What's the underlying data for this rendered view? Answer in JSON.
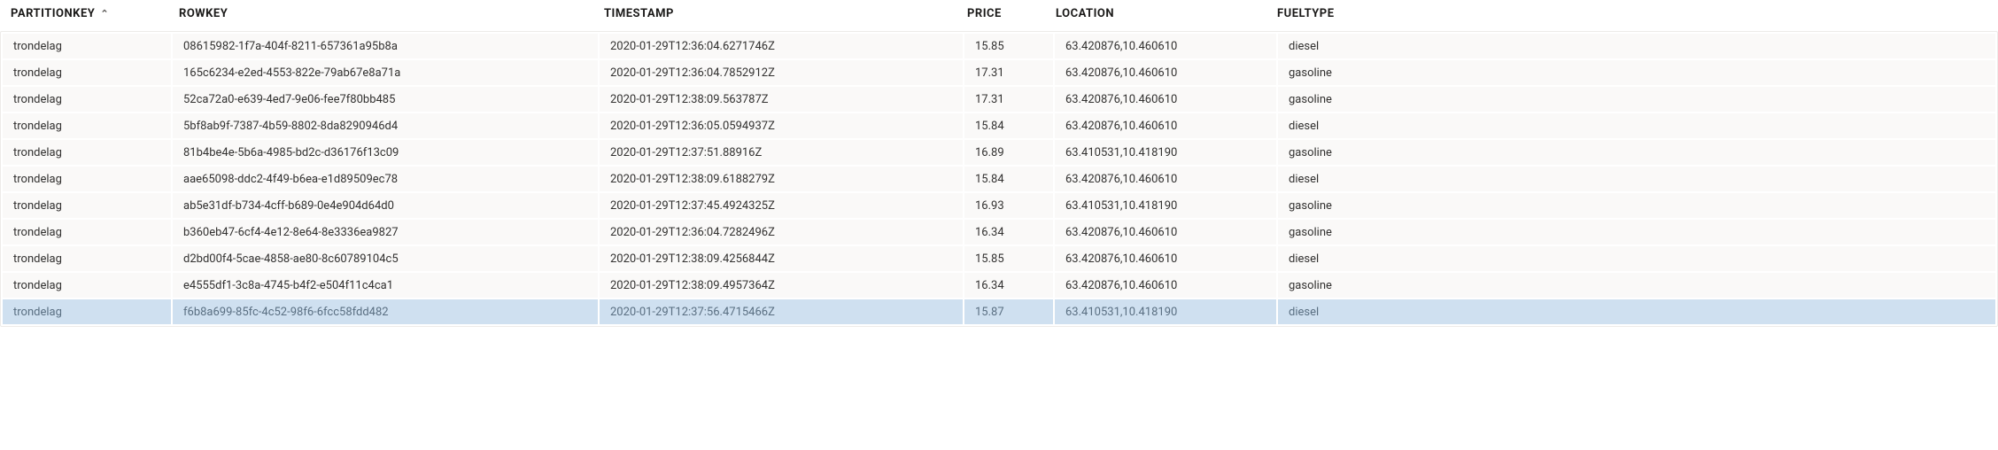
{
  "table": {
    "columns": [
      {
        "key": "partitionkey",
        "label": "PARTITIONKEY",
        "sorted": "asc"
      },
      {
        "key": "rowkey",
        "label": "ROWKEY"
      },
      {
        "key": "timestamp",
        "label": "TIMESTAMP"
      },
      {
        "key": "price",
        "label": "PRICE"
      },
      {
        "key": "location",
        "label": "LOCATION"
      },
      {
        "key": "fueltype",
        "label": "FUELTYPE"
      }
    ],
    "rows": [
      {
        "partitionkey": "trondelag",
        "rowkey": "08615982-1f7a-404f-8211-657361a95b8a",
        "timestamp": "2020-01-29T12:36:04.6271746Z",
        "price": "15.85",
        "location": "63.420876,10.460610",
        "fueltype": "diesel",
        "selected": false
      },
      {
        "partitionkey": "trondelag",
        "rowkey": "165c6234-e2ed-4553-822e-79ab67e8a71a",
        "timestamp": "2020-01-29T12:36:04.7852912Z",
        "price": "17.31",
        "location": "63.420876,10.460610",
        "fueltype": "gasoline",
        "selected": false
      },
      {
        "partitionkey": "trondelag",
        "rowkey": "52ca72a0-e639-4ed7-9e06-fee7f80bb485",
        "timestamp": "2020-01-29T12:38:09.563787Z",
        "price": "17.31",
        "location": "63.420876,10.460610",
        "fueltype": "gasoline",
        "selected": false
      },
      {
        "partitionkey": "trondelag",
        "rowkey": "5bf8ab9f-7387-4b59-8802-8da8290946d4",
        "timestamp": "2020-01-29T12:36:05.0594937Z",
        "price": "15.84",
        "location": "63.420876,10.460610",
        "fueltype": "diesel",
        "selected": false
      },
      {
        "partitionkey": "trondelag",
        "rowkey": "81b4be4e-5b6a-4985-bd2c-d36176f13c09",
        "timestamp": "2020-01-29T12:37:51.88916Z",
        "price": "16.89",
        "location": "63.410531,10.418190",
        "fueltype": "gasoline",
        "selected": false
      },
      {
        "partitionkey": "trondelag",
        "rowkey": "aae65098-ddc2-4f49-b6ea-e1d89509ec78",
        "timestamp": "2020-01-29T12:38:09.6188279Z",
        "price": "15.84",
        "location": "63.420876,10.460610",
        "fueltype": "diesel",
        "selected": false
      },
      {
        "partitionkey": "trondelag",
        "rowkey": "ab5e31df-b734-4cff-b689-0e4e904d64d0",
        "timestamp": "2020-01-29T12:37:45.4924325Z",
        "price": "16.93",
        "location": "63.410531,10.418190",
        "fueltype": "gasoline",
        "selected": false
      },
      {
        "partitionkey": "trondelag",
        "rowkey": "b360eb47-6cf4-4e12-8e64-8e3336ea9827",
        "timestamp": "2020-01-29T12:36:04.7282496Z",
        "price": "16.34",
        "location": "63.420876,10.460610",
        "fueltype": "gasoline",
        "selected": false
      },
      {
        "partitionkey": "trondelag",
        "rowkey": "d2bd00f4-5cae-4858-ae80-8c60789104c5",
        "timestamp": "2020-01-29T12:38:09.4256844Z",
        "price": "15.85",
        "location": "63.420876,10.460610",
        "fueltype": "diesel",
        "selected": false
      },
      {
        "partitionkey": "trondelag",
        "rowkey": "e4555df1-3c8a-4745-b4f2-e504f11c4ca1",
        "timestamp": "2020-01-29T12:38:09.4957364Z",
        "price": "16.34",
        "location": "63.420876,10.460610",
        "fueltype": "gasoline",
        "selected": false
      },
      {
        "partitionkey": "trondelag",
        "rowkey": "f6b8a699-85fc-4c52-98f6-6fcc58fdd482",
        "timestamp": "2020-01-29T12:37:56.4715466Z",
        "price": "15.87",
        "location": "63.410531,10.418190",
        "fueltype": "diesel",
        "selected": true
      }
    ],
    "sort_icon": "⌃"
  }
}
